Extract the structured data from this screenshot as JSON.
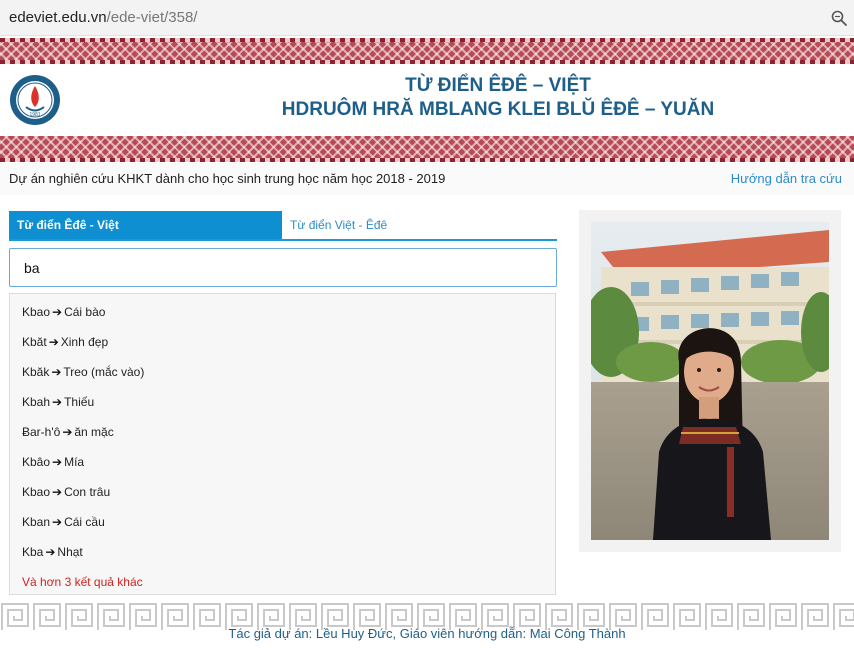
{
  "browser": {
    "url_host": "edeviet.edu.vn",
    "url_path": "/ede-viet/358/",
    "zoom_icon": "magnifier-icon"
  },
  "header": {
    "title_line1": "TỪ ĐIỂN ÊĐÊ – VIỆT",
    "title_line2": "HDRUÔM HRĂ MBLANG KLEI BLŬ ÊĐÊ – YUĂN",
    "logo_text": "1981"
  },
  "subheader": {
    "project": "Dự án nghiên cứu KHKT dành cho học sinh trung học năm học 2018 - 2019",
    "guide_link": "Hướng dẫn tra cứu"
  },
  "tabs": [
    {
      "label": "Từ điển Êđê - Việt",
      "active": true
    },
    {
      "label": "Từ điển Việt - Êđê",
      "active": false
    }
  ],
  "search": {
    "value": "ba"
  },
  "results": [
    {
      "source": "Kbao",
      "target": "Cái bào"
    },
    {
      "source": "Kbăt",
      "target": "Xinh đẹp"
    },
    {
      "source": "Kbăk",
      "target": "Treo (mắc vào)"
    },
    {
      "source": "Kbah",
      "target": "Thiếu"
    },
    {
      "source": "Ƀar-h'ô",
      "target": "ăn mặc"
    },
    {
      "source": "Kbâo",
      "target": "Mía"
    },
    {
      "source": "Kbao",
      "target": "Con trâu"
    },
    {
      "source": "Kban",
      "target": "Cái cầu"
    },
    {
      "source": "Kba",
      "target": "Nhạt"
    }
  ],
  "more_results": "Và hơn 3 kết quả khác",
  "footer": {
    "credit": "Tác giả dự án: Lều Huy Đức, Giáo viên hướng dẫn: Mai Công Thành"
  },
  "colors": {
    "brand_blue": "#1e5f8a",
    "tab_active": "#0d8fd2",
    "link": "#2b8ccc",
    "more_red": "#d42020",
    "band_red": "#b84a55"
  }
}
